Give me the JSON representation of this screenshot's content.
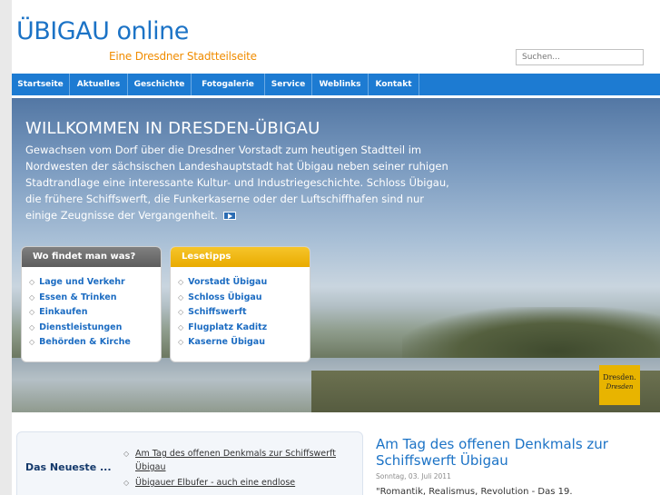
{
  "header": {
    "title": "ÜBIGAU online",
    "subtitle": "Eine Dresdner Stadtteilseite",
    "search_placeholder": "Suchen..."
  },
  "nav": {
    "items": [
      "Startseite",
      "Aktuelles",
      "Geschichte",
      "Fotogalerie",
      "Service",
      "Weblinks",
      "Kontakt"
    ]
  },
  "hero": {
    "title": "WILLKOMMEN IN DRESDEN-ÜBIGAU",
    "text": "Gewachsen vom Dorf über die Dresdner Vorstadt zum heutigen Stadtteil im Nordwesten der sächsischen Landeshauptstadt hat Übigau neben seiner ruhigen Stadtrandlage eine interessante Kultur- und Industriegeschichte. Schloss Übigau, die frühere Schiffswerft, die Funkerkaserne oder der Luftschiffhafen sind nur einige Zeugnisse der Vergangenheit."
  },
  "box_find": {
    "title": "Wo findet man was?",
    "items": [
      "Lage und Verkehr",
      "Essen & Trinken",
      "Einkaufen",
      "Dienstleistungen",
      "Behörden & Kirche"
    ]
  },
  "box_tips": {
    "title": "Lesetipps",
    "items": [
      "Vorstadt Übigau",
      "Schloss Übigau",
      "Schiffswerft",
      "Flugplatz Kaditz",
      "Kaserne Übigau"
    ]
  },
  "badge": {
    "line1": "Dresden.",
    "line2": "Dresden"
  },
  "newest": {
    "label": "Das Neueste ...",
    "items": [
      "Am Tag des offenen Denkmals zur Schiffswerft Übigau",
      "Übigauer Elbufer - auch eine endlose"
    ]
  },
  "article": {
    "title": "Am Tag des offenen Denkmals zur Schiffswerft Übigau",
    "date": "Sonntag, 03. Juli 2011",
    "text": "\"Romantik, Realismus, Revolution - Das 19."
  },
  "colors": {
    "brand_blue": "#1c73c6",
    "nav_blue": "#1d7bd2",
    "accent_orange": "#f08c00",
    "box_yellow": "#e9ab00"
  },
  "icons": {
    "more": "play-arrow-icon",
    "bullet": "diamond-bullet-icon"
  }
}
